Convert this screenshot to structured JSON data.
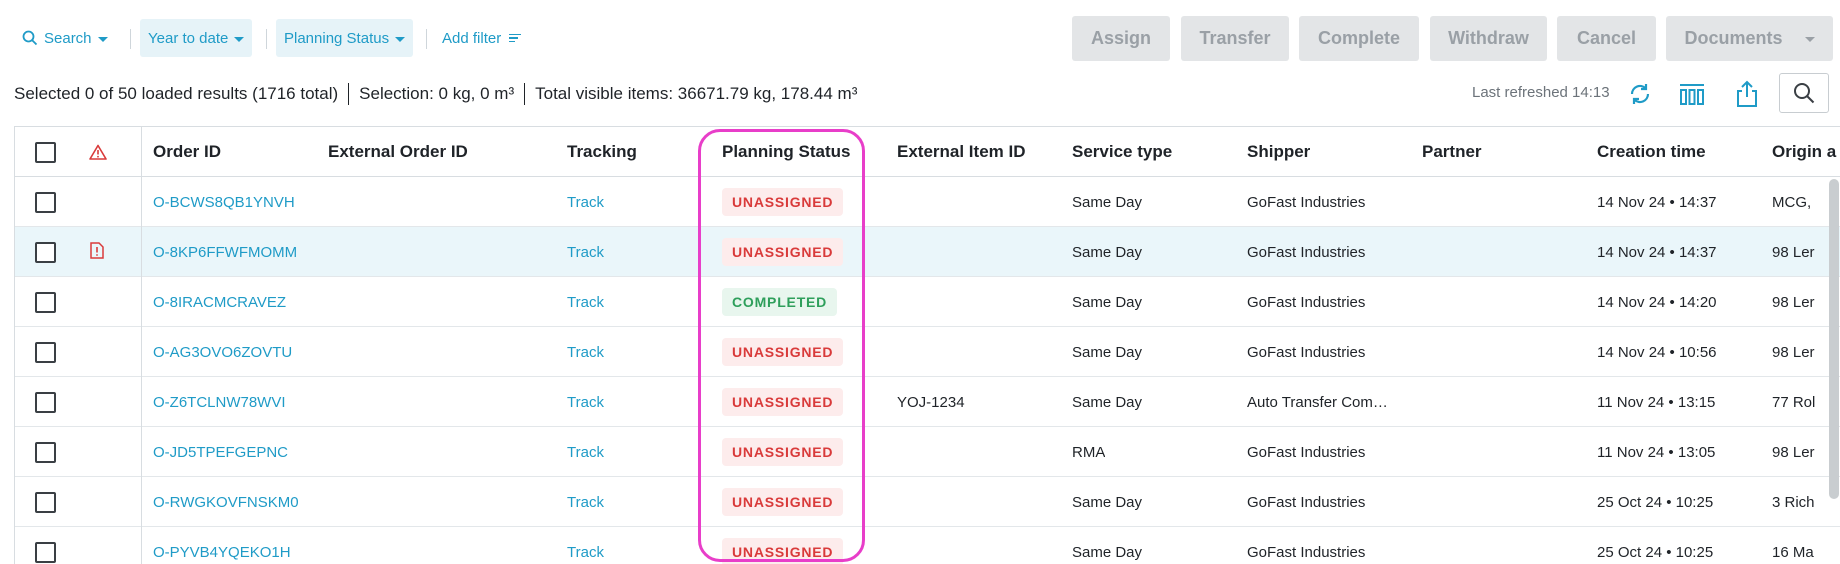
{
  "toolbar": {
    "search_label": "Search",
    "date_filter_label": "Year to date",
    "planning_filter_label": "Planning Status",
    "add_filter_label": "Add filter",
    "actions": {
      "assign": "Assign",
      "transfer": "Transfer",
      "complete": "Complete",
      "withdraw": "Withdraw",
      "cancel": "Cancel",
      "documents": "Documents"
    }
  },
  "summary": {
    "selected": "Selected 0 of 50 loaded results (1716 total)",
    "selection": "Selection: 0 kg, 0 m³",
    "total_visible": "Total visible items: 36671.79 kg, 178.44 m³",
    "last_refreshed": "Last refreshed 14:13"
  },
  "colors": {
    "accent": "#1f9bc7",
    "unassigned": "#d93a3a",
    "completed": "#2e9f5b",
    "highlight_outline": "#e83ec9"
  },
  "table": {
    "headers": {
      "order_id": "Order ID",
      "external_order_id": "External Order ID",
      "tracking": "Tracking",
      "planning_status": "Planning Status",
      "external_item_id": "External Item ID",
      "service_type": "Service type",
      "shipper": "Shipper",
      "partner": "Partner",
      "creation_time": "Creation time",
      "origin": "Origin a"
    },
    "rows": [
      {
        "order_id": "O-BCWS8QB1YNVH",
        "tracking": "Track",
        "status": "UNASSIGNED",
        "external_item_id": "",
        "service_type": "Same Day",
        "shipper": "GoFast Industries",
        "partner": "",
        "creation_time": "14 Nov 24 • 14:37",
        "origin": "MCG,",
        "alert": false
      },
      {
        "order_id": "O-8KP6FFWFMOMM",
        "tracking": "Track",
        "status": "UNASSIGNED",
        "external_item_id": "",
        "service_type": "Same Day",
        "shipper": "GoFast Industries",
        "partner": "",
        "creation_time": "14 Nov 24 • 14:37",
        "origin": "98 Ler",
        "alert": true
      },
      {
        "order_id": "O-8IRACMCRAVEZ",
        "tracking": "Track",
        "status": "COMPLETED",
        "external_item_id": "",
        "service_type": "Same Day",
        "shipper": "GoFast Industries",
        "partner": "",
        "creation_time": "14 Nov 24 • 14:20",
        "origin": "98 Ler",
        "alert": false
      },
      {
        "order_id": "O-AG3OVO6ZOVTU",
        "tracking": "Track",
        "status": "UNASSIGNED",
        "external_item_id": "",
        "service_type": "Same Day",
        "shipper": "GoFast Industries",
        "partner": "",
        "creation_time": "14 Nov 24 • 10:56",
        "origin": "98 Ler",
        "alert": false
      },
      {
        "order_id": "O-Z6TCLNW78WVI",
        "tracking": "Track",
        "status": "UNASSIGNED",
        "external_item_id": "YOJ-1234",
        "service_type": "Same Day",
        "shipper": "Auto Transfer Com…",
        "partner": "",
        "creation_time": "11 Nov 24 • 13:15",
        "origin": "77 Rol",
        "alert": false
      },
      {
        "order_id": "O-JD5TPEFGEPNC",
        "tracking": "Track",
        "status": "UNASSIGNED",
        "external_item_id": "",
        "service_type": "RMA",
        "shipper": "GoFast Industries",
        "partner": "",
        "creation_time": "11 Nov 24 • 13:05",
        "origin": "98 Ler",
        "alert": false
      },
      {
        "order_id": "O-RWGKOVFNSKM0",
        "tracking": "Track",
        "status": "UNASSIGNED",
        "external_item_id": "",
        "service_type": "Same Day",
        "shipper": "GoFast Industries",
        "partner": "",
        "creation_time": "25 Oct 24 • 10:25",
        "origin": "3 Rich",
        "alert": false
      },
      {
        "order_id": "O-PYVB4YQEKO1H",
        "tracking": "Track",
        "status": "UNASSIGNED",
        "external_item_id": "",
        "service_type": "Same Day",
        "shipper": "GoFast Industries",
        "partner": "",
        "creation_time": "25 Oct 24 • 10:25",
        "origin": "16 Ma",
        "alert": false
      }
    ]
  }
}
